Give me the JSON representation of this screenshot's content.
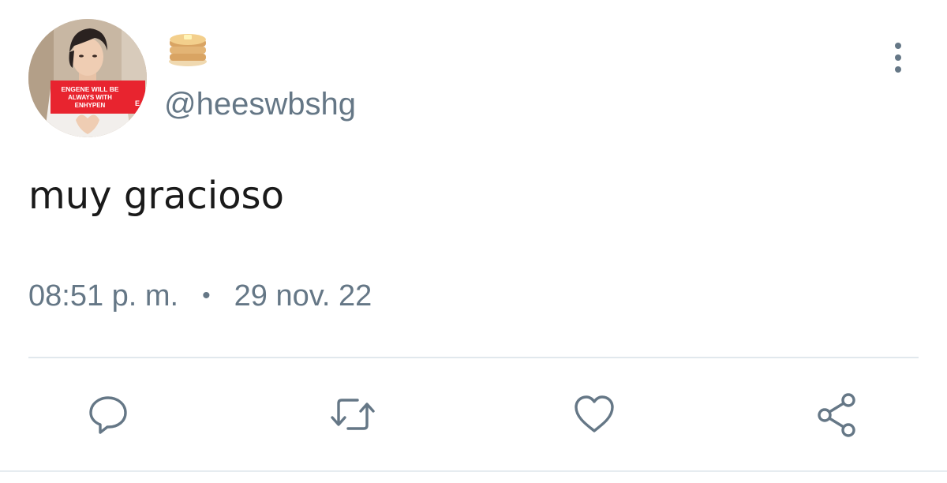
{
  "tweet": {
    "display_name_icon": "pancakes-emoji",
    "handle": "@heeswbshg",
    "text": "muy gracioso",
    "time": "08:51 p. m.",
    "separator": "•",
    "date": "29 nov. 22"
  },
  "avatar": {
    "sign_line_1": "ENGENE WILL BE",
    "sign_line_2": "ALWAYS WITH",
    "sign_line_3": "ENHYPEN",
    "sign_line_side": "E"
  },
  "actions": [
    {
      "icon": "reply-icon"
    },
    {
      "icon": "retweet-icon"
    },
    {
      "icon": "like-icon"
    },
    {
      "icon": "share-icon"
    }
  ],
  "colors": {
    "secondary_text": "#657786",
    "primary_text": "#1a1a1a",
    "divider": "#e1e8ed",
    "sign_red": "#e8242f"
  }
}
